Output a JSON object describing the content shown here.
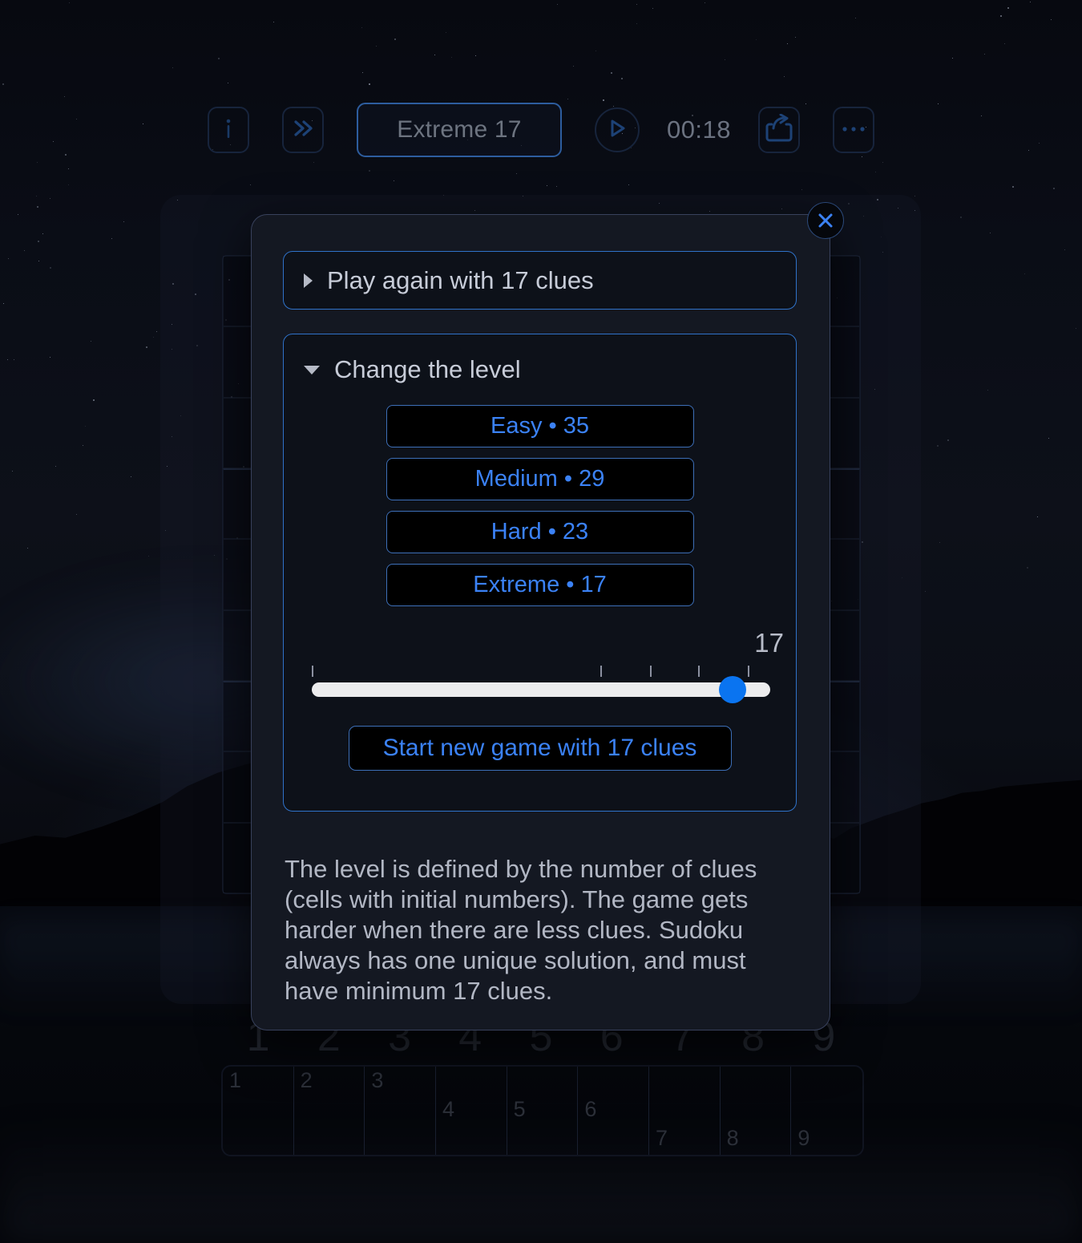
{
  "toolbar": {
    "info_icon": "info-icon",
    "fast_forward_icon": "double-chevron-right-icon",
    "level_label": "Extreme 17",
    "play_icon": "play-icon",
    "timer": "00:18",
    "share_icon": "share-icon",
    "more_icon": "ellipsis-icon"
  },
  "dialog": {
    "close_icon": "close-icon",
    "play_again": {
      "label": "Play again with 17 clues",
      "expanded": false,
      "marker": "triangle-right"
    },
    "change_level": {
      "label": "Change the level",
      "expanded": true,
      "marker": "triangle-down",
      "levels": [
        {
          "name": "Easy",
          "clues": 35,
          "label": "Easy • 35"
        },
        {
          "name": "Medium",
          "clues": 29,
          "label": "Medium • 29"
        },
        {
          "name": "Hard",
          "clues": 23,
          "label": "Hard • 23"
        },
        {
          "name": "Extreme",
          "clues": 17,
          "label": "Extreme • 17"
        }
      ],
      "slider": {
        "value": "17",
        "min": 17,
        "max": 40,
        "ticks": [
          17,
          23,
          29,
          35,
          40
        ]
      },
      "start_button": "Start new game with 17 clues"
    },
    "description": "The level is defined by the number of clues (cells with initial numbers). The game gets harder when there are less clues. Sudoku always has one unique solution, and must have minimum 17 clues."
  },
  "background": {
    "numpad": [
      "1",
      "2",
      "3",
      "4",
      "5",
      "6",
      "7",
      "8",
      "9"
    ],
    "lower_row": [
      "1",
      "2",
      "3",
      "4",
      "5",
      "6",
      "7",
      "8",
      "9"
    ]
  },
  "colors": {
    "accent_blue": "#3b82f6",
    "slider_thumb": "#0a74f0",
    "panel_border": "#2f72c9",
    "dialog_bg": "#141822",
    "text_primary": "#c7ccd8"
  }
}
